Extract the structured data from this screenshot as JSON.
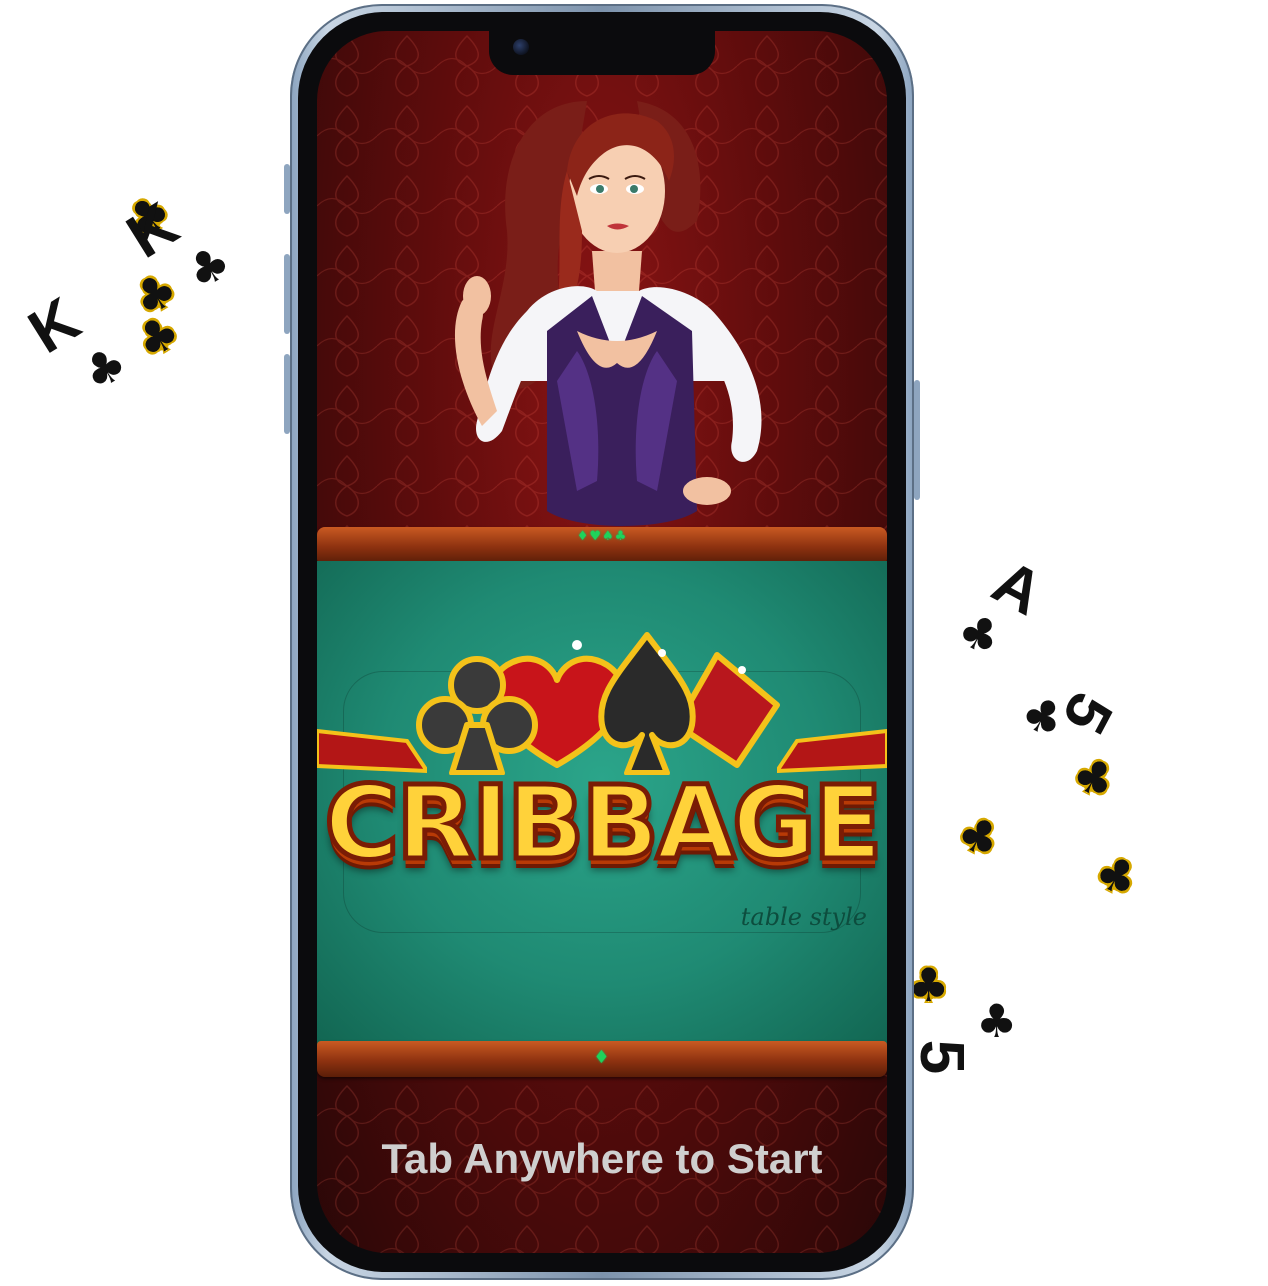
{
  "game": {
    "title": "CRIBBAGE",
    "subtitle": "table style",
    "start_prompt": "Tab Anywhere to Start"
  },
  "table": {
    "top_rail_gems": "♦♥♠♣",
    "bottom_rail_gem": "♦"
  },
  "cards": [
    {
      "rank": "K",
      "suit": "♣"
    },
    {
      "rank": "K",
      "suit": "♣"
    },
    {
      "rank": "A",
      "suit": "♣"
    },
    {
      "rank": "5",
      "suit": "♣"
    },
    {
      "rank": "5",
      "suit": "♣"
    }
  ],
  "colors": {
    "felt": "#1f8a73",
    "rail": "#8e3210",
    "background": "#5e0c0c",
    "title": "#ffd23a",
    "start_text": "#cfcfcf"
  }
}
